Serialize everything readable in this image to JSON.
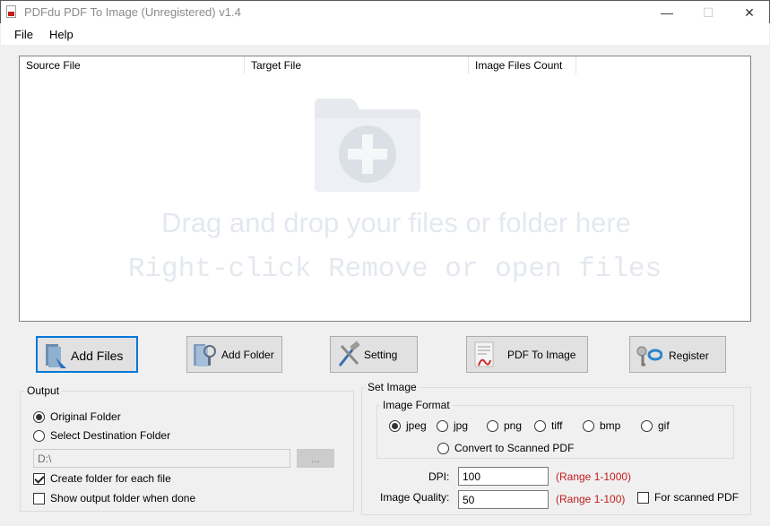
{
  "window": {
    "title": "PDFdu PDF To Image (Unregistered) v1.4",
    "minimize": "—",
    "maximize": "☐",
    "close": "✕"
  },
  "menu": {
    "file": "File",
    "help": "Help"
  },
  "list": {
    "columns": [
      "Source File",
      "Target File",
      "Image Files Count"
    ],
    "drop_hint": "Drag and drop your files or folder here",
    "drop_hint2": "Right-click Remove or open files"
  },
  "buttons": {
    "add_files": "Add Files",
    "add_folder": "Add Folder",
    "setting": "Setting",
    "pdf_to_image": "PDF To Image",
    "register": "Register"
  },
  "output": {
    "title": "Output",
    "original_folder": "Original Folder",
    "select_destination": "Select Destination Folder",
    "path_value": "D:\\",
    "browse_label": "...",
    "create_folder": "Create folder for each file",
    "show_output": "Show output folder when done",
    "original_checked": true,
    "create_checked": true,
    "show_checked": false
  },
  "set_image": {
    "title": "Set Image",
    "format_title": "Image Format",
    "formats": [
      "jpeg",
      "jpg",
      "png",
      "tiff",
      "bmp",
      "gif"
    ],
    "selected_format": "jpeg",
    "scanned_pdf": "Convert to Scanned PDF",
    "dpi_label": "DPI:",
    "dpi_value": "100",
    "dpi_range": "(Range 1-1000)",
    "quality_label": "Image Quality:",
    "quality_value": "50",
    "quality_range": "(Range 1-100)",
    "for_scanned": "For scanned PDF"
  },
  "colors": {
    "accent": "#0078d7",
    "range_text": "#c21d1d",
    "hint_text": "#e4e8ef"
  }
}
